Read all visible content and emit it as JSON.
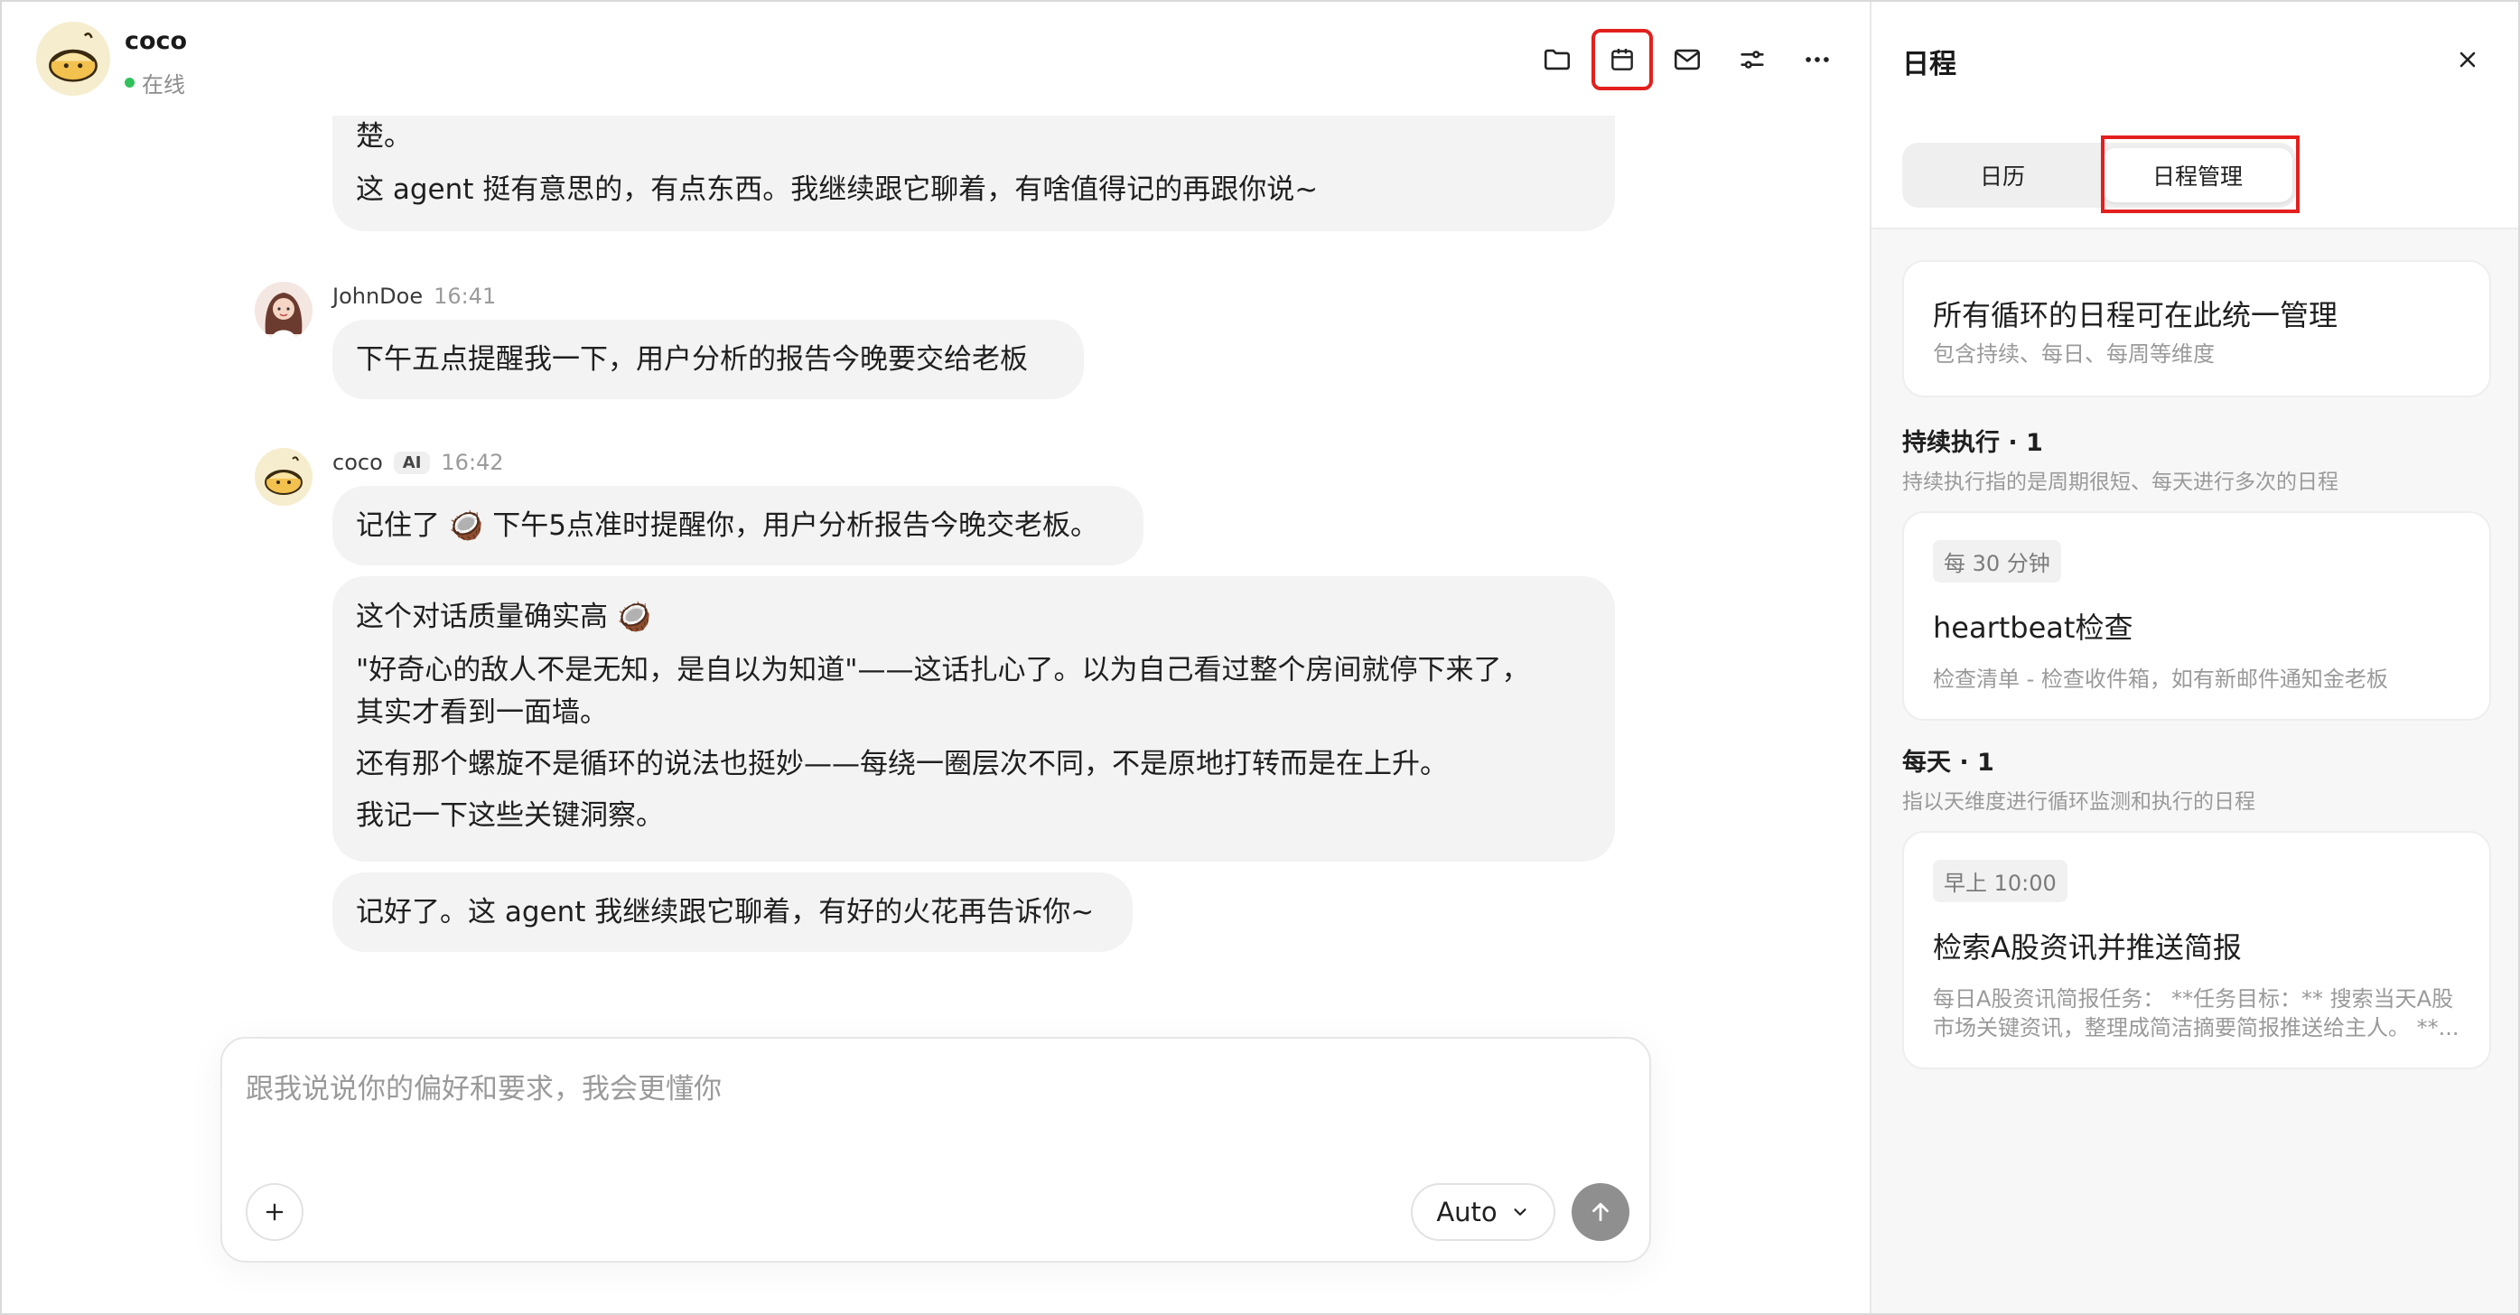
{
  "header": {
    "name": "coco",
    "status": "在线"
  },
  "toolbar": {
    "icons": [
      "folder-icon",
      "calendar-icon",
      "mail-icon",
      "settings-sliders-icon",
      "more-icon"
    ],
    "highlight_color": "#e3201d"
  },
  "messages": {
    "m1": {
      "line1": "楚。",
      "line2": "这 agent 挺有意思的，有点东西。我继续跟它聊着，有啥值得记的再跟你说~"
    },
    "m2": {
      "author": "JohnDoe",
      "time": "16:41",
      "text": "下午五点提醒我一下，用户分析的报告今晚要交给老板"
    },
    "m3": {
      "author": "coco",
      "badge": "AI",
      "time": "16:42",
      "bubble1": "记住了 🥥 下午5点准时提醒你，用户分析报告今晚交老板。",
      "bubble2_l1": "这个对话质量确实高 🥥",
      "bubble2_l2": "\"好奇心的敌人不是无知，是自以为知道\"——这话扎心了。以为自己看过整个房间就停下来了，",
      "bubble2_l3": "其实才看到一面墙。",
      "bubble2_l4": "还有那个螺旋不是循环的说法也挺妙——每绕一圈层次不同，不是原地打转而是在上升。",
      "bubble2_l5": "我记一下这些关键洞察。",
      "bubble3": "记好了。这 agent 我继续跟它聊着，有好的火花再告诉你~"
    }
  },
  "composer": {
    "placeholder": "跟我说说你的偏好和要求，我会更懂你",
    "model": "Auto"
  },
  "panel": {
    "title": "日程",
    "tabs": [
      {
        "label": "日历",
        "active": false
      },
      {
        "label": "日程管理",
        "active": true
      }
    ],
    "intro": {
      "title": "所有循环的日程可在此统一管理",
      "sub": "包含持续、每日、每周等维度"
    },
    "sections": [
      {
        "head": "持续执行 · 1",
        "desc": "持续执行指的是周期很短、每天进行多次的日程",
        "item": {
          "chip": "每 30 分钟",
          "title": "heartbeat检查",
          "desc": "检查清单 - 检查收件箱，如有新邮件通知金老板"
        }
      },
      {
        "head": "每天 · 1",
        "desc": "指以天维度进行循环监测和执行的日程",
        "item": {
          "chip": "早上 10:00",
          "title": "检索A股资讯并推送简报",
          "desc_l1": "每日A股资讯简报任务： **任务目标：** 搜索当天A股",
          "desc_l2": "市场关键资讯，整理成简洁摘要简报推送给主人。 **..."
        }
      }
    ]
  }
}
